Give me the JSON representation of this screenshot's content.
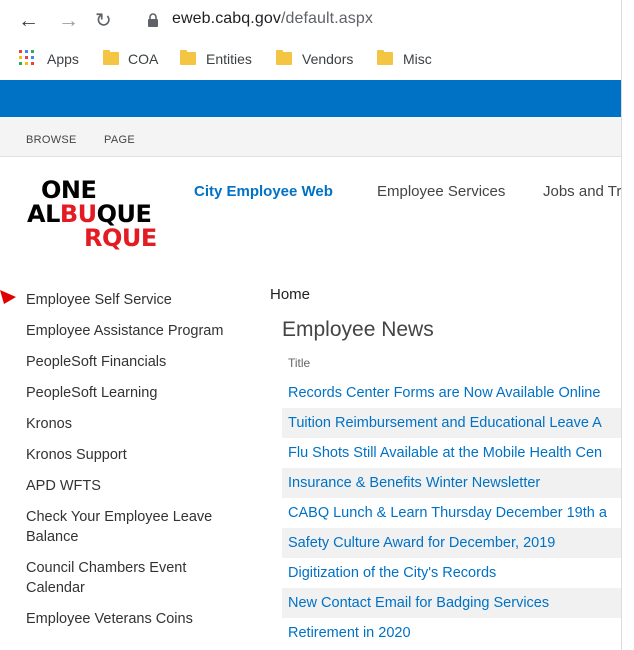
{
  "browser": {
    "url_host": "eweb.cabq.gov",
    "url_path": "/default.aspx",
    "bookmarks": [
      "Apps",
      "COA",
      "Entities",
      "Vendors",
      "Misc"
    ]
  },
  "ribbon": {
    "tabs": [
      "BROWSE",
      "PAGE"
    ]
  },
  "logo": {
    "line1": "ONE",
    "line2_a": "AL",
    "line2_b": "BU",
    "line2_c": "QUE",
    "line3": "RQUE"
  },
  "topnav": {
    "home": "City Employee Web",
    "items": [
      "Employee Services",
      "Jobs and Tr"
    ]
  },
  "leftnav": {
    "items": [
      "Employee Self Service",
      "Employee Assistance Program",
      "PeopleSoft Financials",
      "PeopleSoft Learning",
      "Kronos",
      "Kronos Support",
      "APD WFTS",
      "Check Your Employee Leave Balance",
      "Council Chambers Event Calendar",
      "Employee Veterans Coins"
    ]
  },
  "main": {
    "breadcrumb": "Home",
    "title": "Employee News",
    "column_header": "Title",
    "news": [
      "Records Center Forms are Now Available Online",
      "Tuition Reimbursement and Educational Leave A",
      "Flu Shots Still Available at the Mobile Health Cen",
      "Insurance & Benefits Winter Newsletter",
      "CABQ Lunch & Learn Thursday December 19th a",
      "Safety Culture Award for December, 2019",
      "Digitization of the City's Records",
      "New Contact Email for Badging Services",
      "Retirement in 2020"
    ]
  },
  "colors": {
    "sharepoint_blue": "#0072c6",
    "logo_red": "#e31b23",
    "annotation_arrow": "#e00000"
  }
}
